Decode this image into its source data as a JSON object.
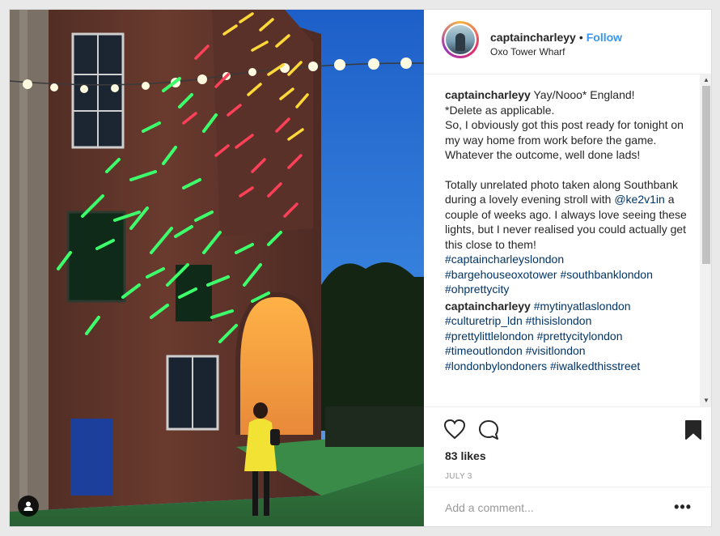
{
  "post": {
    "username": "captaincharleyy",
    "separator": "•",
    "follow_label": "Follow",
    "location": "Oxo Tower Wharf"
  },
  "caption": {
    "username": "captaincharleyy",
    "line1": "Yay/Nooo* England!",
    "line2": "*Delete as applicable.",
    "para1": "So, I obviously got this post ready for tonight on my way home from work before the game. Whatever the outcome, well done lads!",
    "para2_before": "Totally unrelated photo taken along Southbank during a lovely evening stroll with ",
    "para2_mention": "@ke2v1in",
    "para2_after": " a couple of weeks ago. I always love seeing these lights, but I never realised you could actually get this close to them!",
    "hashtags": [
      "#captaincharleyslondon",
      "#bargehouseoxotower",
      "#southbanklondon",
      "#ohprettycity"
    ]
  },
  "comment": {
    "username": "captaincharleyy",
    "hashtags": [
      "#mytinyatlaslondon",
      "#culturetrip_ldn",
      "#thisislondon",
      "#prettylittlelondon",
      "#prettycitylondon",
      "#timeoutlondon",
      "#visitlondon",
      "#londonbylondoners",
      "#iwalkedthisstreet"
    ]
  },
  "actions": {
    "like_icon": "heart-icon",
    "comment_icon": "comment-bubble-icon",
    "save_icon": "bookmark-icon",
    "likes": "83 likes",
    "date": "JULY 3",
    "more_label": "•••"
  },
  "add_comment": {
    "placeholder": "Add a comment..."
  },
  "colors": {
    "link": "#003569",
    "follow": "#3897f0",
    "neon_green": "#39ff6a",
    "neon_red": "#ff3b4e",
    "neon_yellow": "#ffd23a",
    "sky": "#2f6fd0"
  }
}
